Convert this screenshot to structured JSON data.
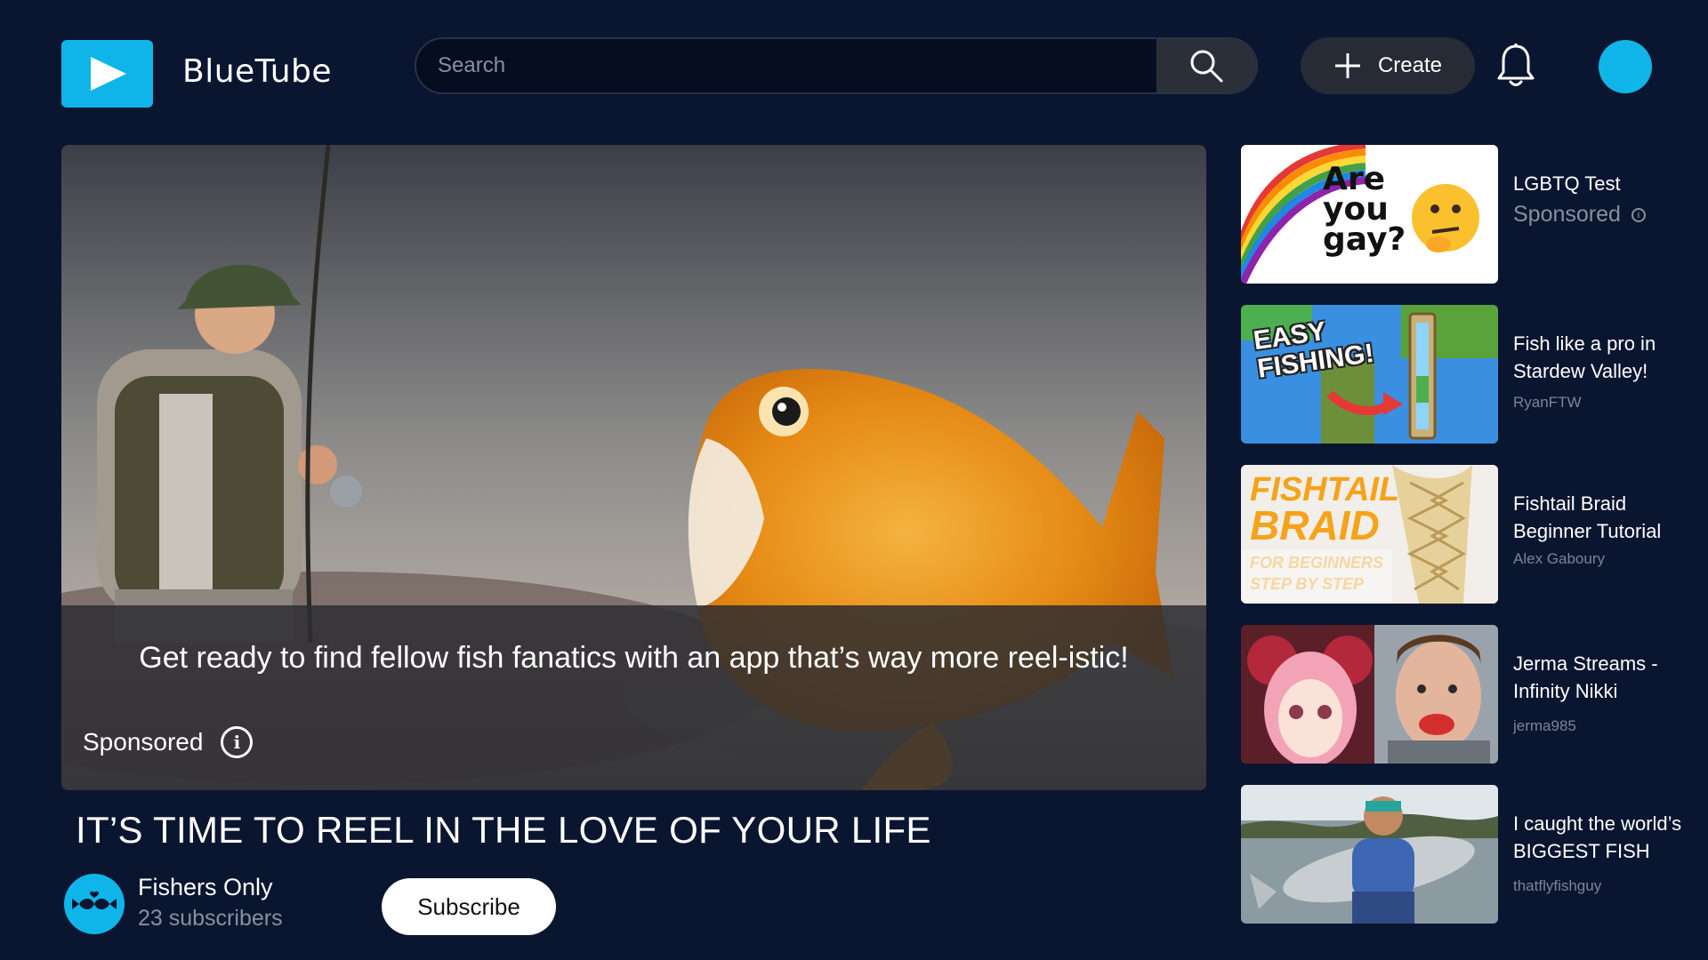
{
  "brand": {
    "name": "BlueTube",
    "color": "#0fb5e8"
  },
  "header": {
    "search_placeholder": "Search",
    "create_label": "Create",
    "icons": [
      "play-logo-icon",
      "search-icon",
      "plus-icon",
      "bell-icon"
    ]
  },
  "video": {
    "caption": "Get ready to find fellow fish fanatics with an app that’s way more reel-istic!",
    "sponsored_label": "Sponsored",
    "title": "IT’S TIME TO REEL IN THE LOVE OF YOUR LIFE",
    "channel": {
      "name": "Fishers Only",
      "subscribers": "23 subscribers"
    },
    "subscribe_label": "Subscribe"
  },
  "sidebar": {
    "items": [
      {
        "title": "LGBTQ Test",
        "meta": "Sponsored",
        "thumb_text": [
          "Are",
          "you",
          "gay?"
        ]
      },
      {
        "title": "Fish like a pro in Stardew Valley!",
        "meta": "RyanFTW",
        "thumb_text": [
          "EASY",
          "FISHING!"
        ]
      },
      {
        "title": "Fishtail Braid Beginner Tutorial",
        "meta": "Alex Gaboury",
        "thumb_text": [
          "FISHTAIL",
          "BRAID",
          "FOR BEGINNERS",
          "STEP BY STEP"
        ]
      },
      {
        "title": "Jerma Streams - Infinity Nikki",
        "meta": "jerma985",
        "thumb_text": []
      },
      {
        "title": "I caught the world’s BIGGEST FISH",
        "meta": "thatflyfishguy",
        "thumb_text": []
      }
    ]
  }
}
